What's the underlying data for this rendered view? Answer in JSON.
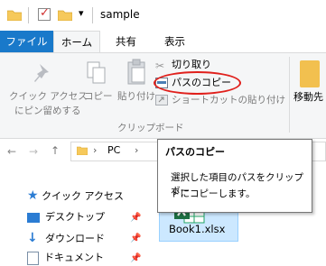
{
  "window": {
    "title": "sample"
  },
  "tabs": {
    "file": "ファイル",
    "home": "ホーム",
    "share": "共有",
    "view": "表示"
  },
  "ribbon": {
    "quick_access_line1": "クイック アクセス",
    "quick_access_line2": "にピン留めする",
    "copy": "コピー",
    "paste": "貼り付け",
    "cut": "切り取り",
    "copy_path": "パスのコピー",
    "paste_shortcut": "ショートカットの貼り付け",
    "clipboard_group": "クリップボード",
    "move_to": "移動先"
  },
  "address": {
    "chevron": "›",
    "pc": "PC",
    "nav_back": "←",
    "nav_forward": "→",
    "nav_up": "↑"
  },
  "tooltip": {
    "title": "パスのコピー",
    "line1": "選択した項目のパスをクリップボー",
    "line2": "ドにコピーします。"
  },
  "nav_pane": {
    "quick_access": "クイック アクセス",
    "items": [
      {
        "label": "デスクトップ",
        "icon": "desktop-icon"
      },
      {
        "label": "ダウンロード",
        "icon": "download-icon"
      },
      {
        "label": "ドキュメント",
        "icon": "document-icon"
      }
    ]
  },
  "file": {
    "name": "Book1.xlsx",
    "icon": "excel-file-icon"
  },
  "colors": {
    "file_tab": "#1979ca",
    "highlight_ellipse": "#e0201c",
    "selection": "#cce8ff"
  }
}
